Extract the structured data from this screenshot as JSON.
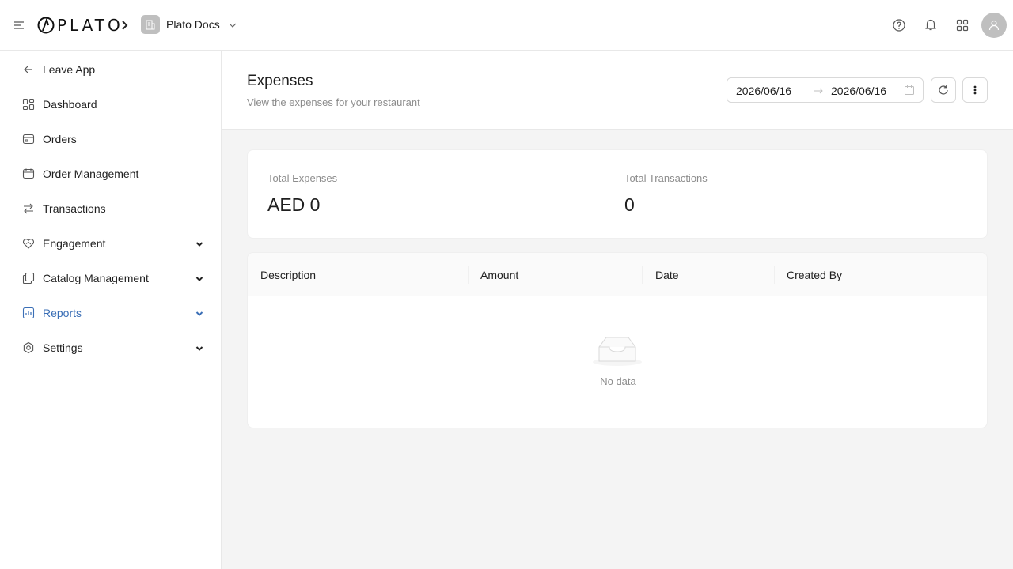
{
  "brand": {
    "logo_text": "PLATO"
  },
  "workspace": {
    "name": "Plato Docs"
  },
  "sidebar": {
    "items": [
      {
        "label": "Leave App"
      },
      {
        "label": "Dashboard"
      },
      {
        "label": "Orders"
      },
      {
        "label": "Order Management"
      },
      {
        "label": "Transactions"
      },
      {
        "label": "Engagement"
      },
      {
        "label": "Catalog Management"
      },
      {
        "label": "Reports"
      },
      {
        "label": "Settings"
      }
    ]
  },
  "header": {
    "title": "Expenses",
    "subtitle": "View the expenses for your restaurant",
    "date_start": "2026/06/16",
    "date_end": "2026/06/16"
  },
  "stats": {
    "total_expenses_label": "Total Expenses",
    "total_expenses_value": "AED 0",
    "total_transactions_label": "Total Transactions",
    "total_transactions_value": "0"
  },
  "table": {
    "columns": [
      "Description",
      "Amount",
      "Date",
      "Created By"
    ],
    "empty_text": "No data"
  },
  "colors": {
    "accent": "#3b6fb6",
    "muted": "#8c8c8c",
    "border": "#e8e8e8"
  }
}
